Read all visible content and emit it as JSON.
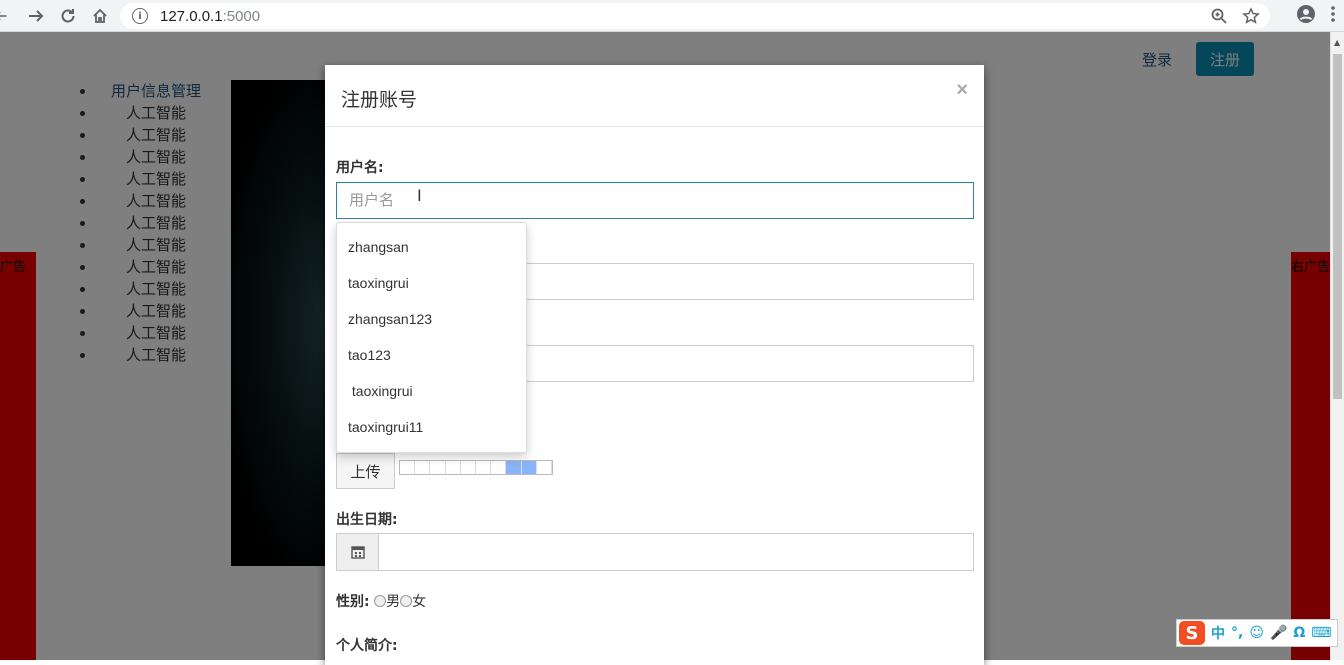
{
  "browser": {
    "url_host": "127.0.0.1",
    "url_port": ":5000",
    "info_glyph": "i"
  },
  "page": {
    "nav": {
      "login": "登录",
      "register": "注册"
    },
    "side_list": [
      "用户信息管理",
      "人工智能",
      "人工智能",
      "人工智能",
      "人工智能",
      "人工智能",
      "人工智能",
      "人工智能",
      "人工智能",
      "人工智能",
      "人工智能",
      "人工智能",
      "人工智能"
    ],
    "ad_left_text": "广告",
    "ad_right_text": "右广告"
  },
  "modal": {
    "title": "注册账号",
    "close": "×",
    "username_label": "用户名:",
    "username_placeholder": "用户名",
    "autocomplete": [
      "zhangsan",
      "taoxingrui",
      "zhangsan123",
      "tao123",
      " taoxingrui",
      "taoxingrui11"
    ],
    "upload_label": "上传",
    "upload_progress": 0.2,
    "birthdate_label": "出生日期:",
    "gender_label": "性别:",
    "gender_options": [
      "男",
      "女"
    ],
    "bio_label": "个人简介:"
  },
  "ime": {
    "logo": "S",
    "items": [
      "中",
      "°,",
      "☺",
      "🎤",
      "Ω",
      "⌨"
    ]
  }
}
